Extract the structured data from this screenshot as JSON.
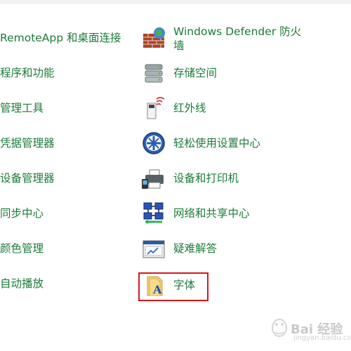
{
  "left_items": [
    {
      "label": "RemoteApp 和桌面连接"
    },
    {
      "label": "程序和功能"
    },
    {
      "label": "管理工具"
    },
    {
      "label": "凭据管理器"
    },
    {
      "label": "设备管理器"
    },
    {
      "label": "同步中心"
    },
    {
      "label": "颜色管理"
    },
    {
      "label": "自动播放"
    }
  ],
  "right_items": [
    {
      "label_line1": "Windows Defender 防火",
      "label_line2": "墙",
      "icon": "firewall-icon"
    },
    {
      "label": "存储空间",
      "icon": "storage-spaces-icon"
    },
    {
      "label": "红外线",
      "icon": "infrared-icon"
    },
    {
      "label": "轻松使用设置中心",
      "icon": "ease-of-access-icon"
    },
    {
      "label": "设备和打印机",
      "icon": "devices-printers-icon"
    },
    {
      "label": "网络和共享中心",
      "icon": "network-sharing-icon"
    },
    {
      "label": "疑难解答",
      "icon": "troubleshooting-icon"
    },
    {
      "label": "字体",
      "icon": "fonts-folder-icon"
    }
  ],
  "watermark": {
    "text": "Bai 经验",
    "sub": "jingyan.baidu.com"
  },
  "colors": {
    "link": "#1e7b3a",
    "highlight": "#d9161b"
  }
}
